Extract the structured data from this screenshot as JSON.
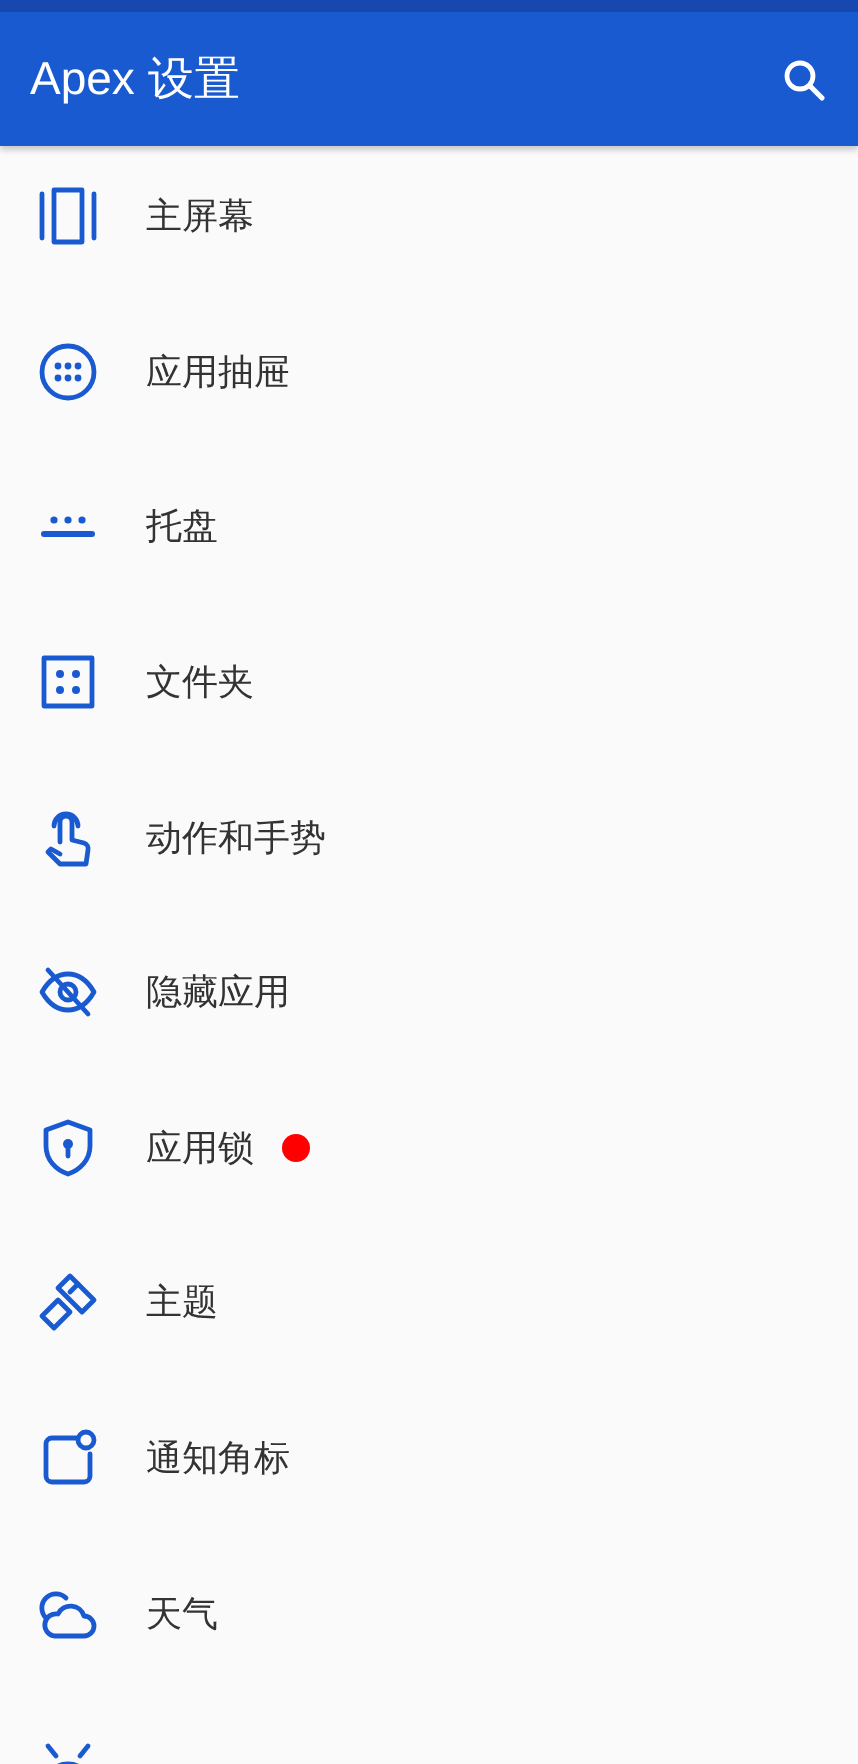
{
  "app_bar": {
    "title": "Apex 设置"
  },
  "menu": [
    {
      "label": "主屏幕",
      "dot": false
    },
    {
      "label": "应用抽屉",
      "dot": false
    },
    {
      "label": "托盘",
      "dot": false
    },
    {
      "label": "文件夹",
      "dot": false
    },
    {
      "label": "动作和手势",
      "dot": false
    },
    {
      "label": "隐藏应用",
      "dot": false
    },
    {
      "label": "应用锁",
      "dot": true
    },
    {
      "label": "主题",
      "dot": false
    },
    {
      "label": "通知角标",
      "dot": false
    },
    {
      "label": "天气",
      "dot": false
    }
  ],
  "partial_item": true
}
